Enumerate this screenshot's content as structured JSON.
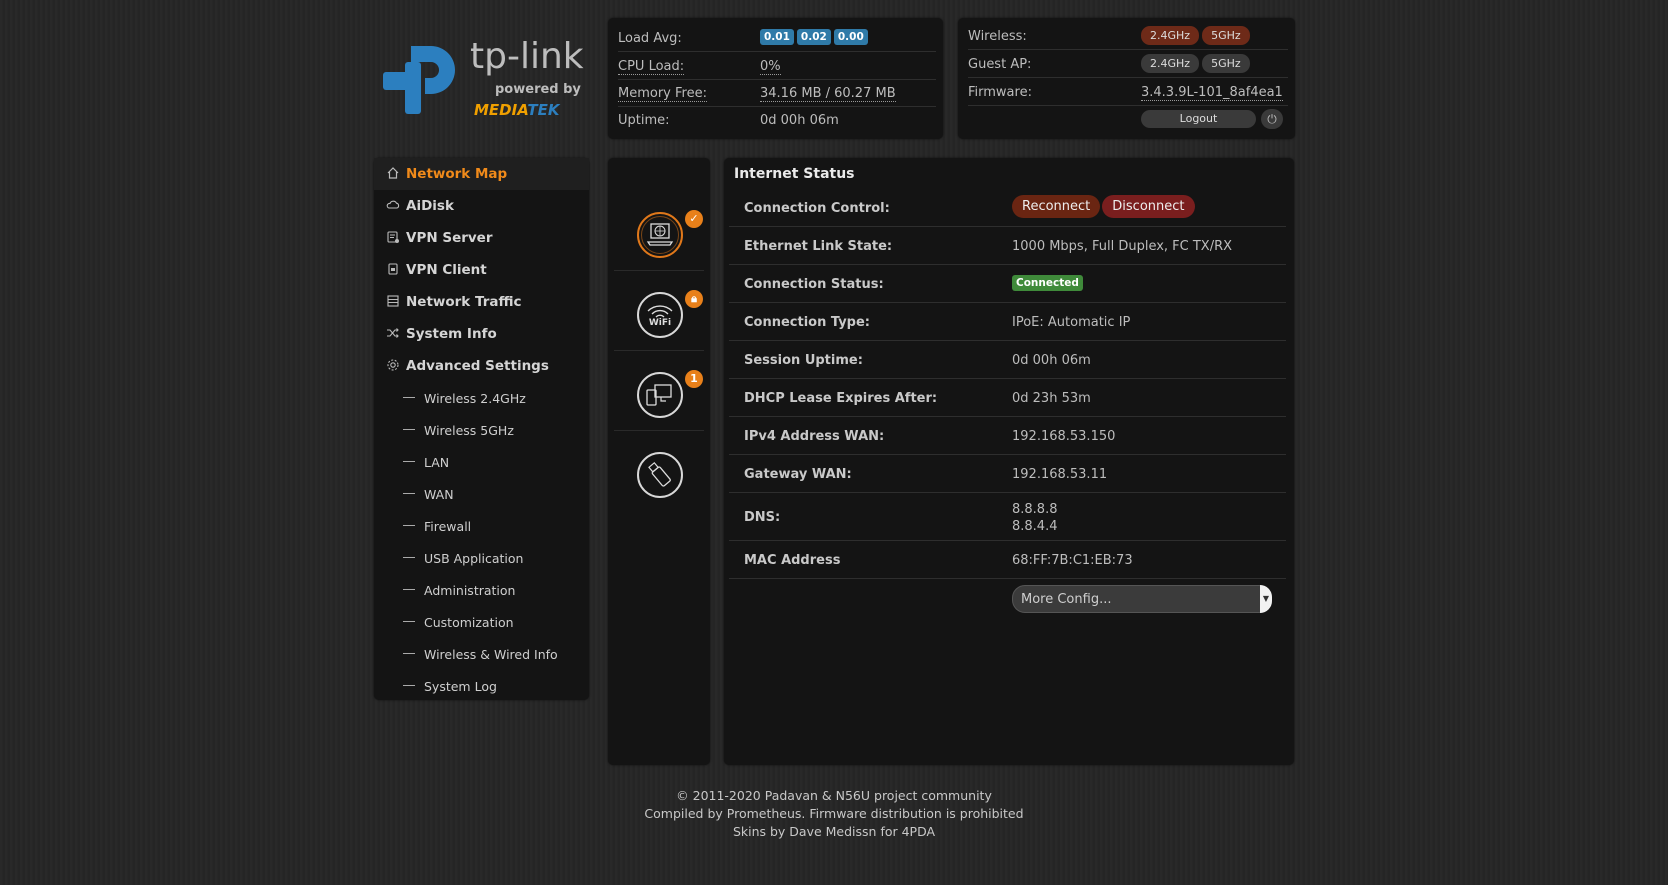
{
  "logo": {
    "brand": "tp-link",
    "powered_by": "powered by",
    "partner_a": "MEDIA",
    "partner_b": "TEK"
  },
  "status_left": {
    "load_avg_label": "Load Avg:",
    "load_avg": [
      "0.01",
      "0.02",
      "0.00"
    ],
    "cpu_label": "CPU Load:",
    "cpu_value": "0%",
    "memory_label": "Memory Free:",
    "memory_value": "34.16 MB / 60.27 MB",
    "uptime_label": "Uptime:",
    "uptime_value": "0d 00h 06m"
  },
  "status_right": {
    "wireless_label": "Wireless:",
    "wireless_24": "2.4GHz",
    "wireless_5": "5GHz",
    "guest_label": "Guest AP:",
    "guest_24": "2.4GHz",
    "guest_5": "5GHz",
    "firmware_label": "Firmware:",
    "firmware_value": "3.4.3.9L-101_8af4ea1",
    "logout_label": "Logout",
    "power_icon": "power-icon"
  },
  "nav": {
    "items": [
      {
        "label": "Network Map",
        "icon": "home-icon"
      },
      {
        "label": "AiDisk",
        "icon": "cloud-icon"
      },
      {
        "label": "VPN Server",
        "icon": "vpn-server-icon"
      },
      {
        "label": "VPN Client",
        "icon": "vpn-client-icon"
      },
      {
        "label": "Network Traffic",
        "icon": "traffic-icon"
      },
      {
        "label": "System Info",
        "icon": "shuffle-icon"
      },
      {
        "label": "Advanced Settings",
        "icon": "gear-icon"
      }
    ],
    "sub_items": [
      "Wireless 2.4GHz",
      "Wireless 5GHz",
      "LAN",
      "WAN",
      "Firewall",
      "USB Application",
      "Administration",
      "Customization",
      "Wireless & Wired Info",
      "System Log"
    ]
  },
  "icon_column": {
    "wifi_text": "WiFi",
    "clients_count": "1"
  },
  "main": {
    "title": "Internet Status",
    "connection_control_label": "Connection Control:",
    "reconnect_label": "Reconnect",
    "disconnect_label": "Disconnect",
    "ethernet_label": "Ethernet Link State:",
    "ethernet_value": "1000 Mbps, Full Duplex, FC TX/RX",
    "conn_status_label": "Connection Status:",
    "conn_status_value": "Connected",
    "conn_type_label": "Connection Type:",
    "conn_type_value": "IPoE: Automatic IP",
    "session_label": "Session Uptime:",
    "session_value": "0d 00h 06m",
    "dhcp_label": "DHCP Lease Expires After:",
    "dhcp_value": "0d 23h 53m",
    "ipv4_label": "IPv4 Address WAN:",
    "ipv4_value": "192.168.53.150",
    "gateway_label": "Gateway WAN:",
    "gateway_value": "192.168.53.11",
    "dns_label": "DNS:",
    "dns_values": [
      "8.8.8.8",
      "8.8.4.4"
    ],
    "mac_label": "MAC Address",
    "mac_value": "68:FF:7B:C1:EB:73",
    "more_config": "More Config..."
  },
  "footer": {
    "line1": "© 2011-2020 Padavan & N56U project community",
    "line2": "Compiled by Prometheus. Firmware distribution is prohibited",
    "line3": "Skins by Dave Medissn for 4PDA"
  },
  "colors": {
    "accent": "#f08a1a",
    "panel": "#141414",
    "badge_blue": "#2f7aa8",
    "badge_green": "#3f8a3a",
    "button_red": "#6a2512"
  }
}
